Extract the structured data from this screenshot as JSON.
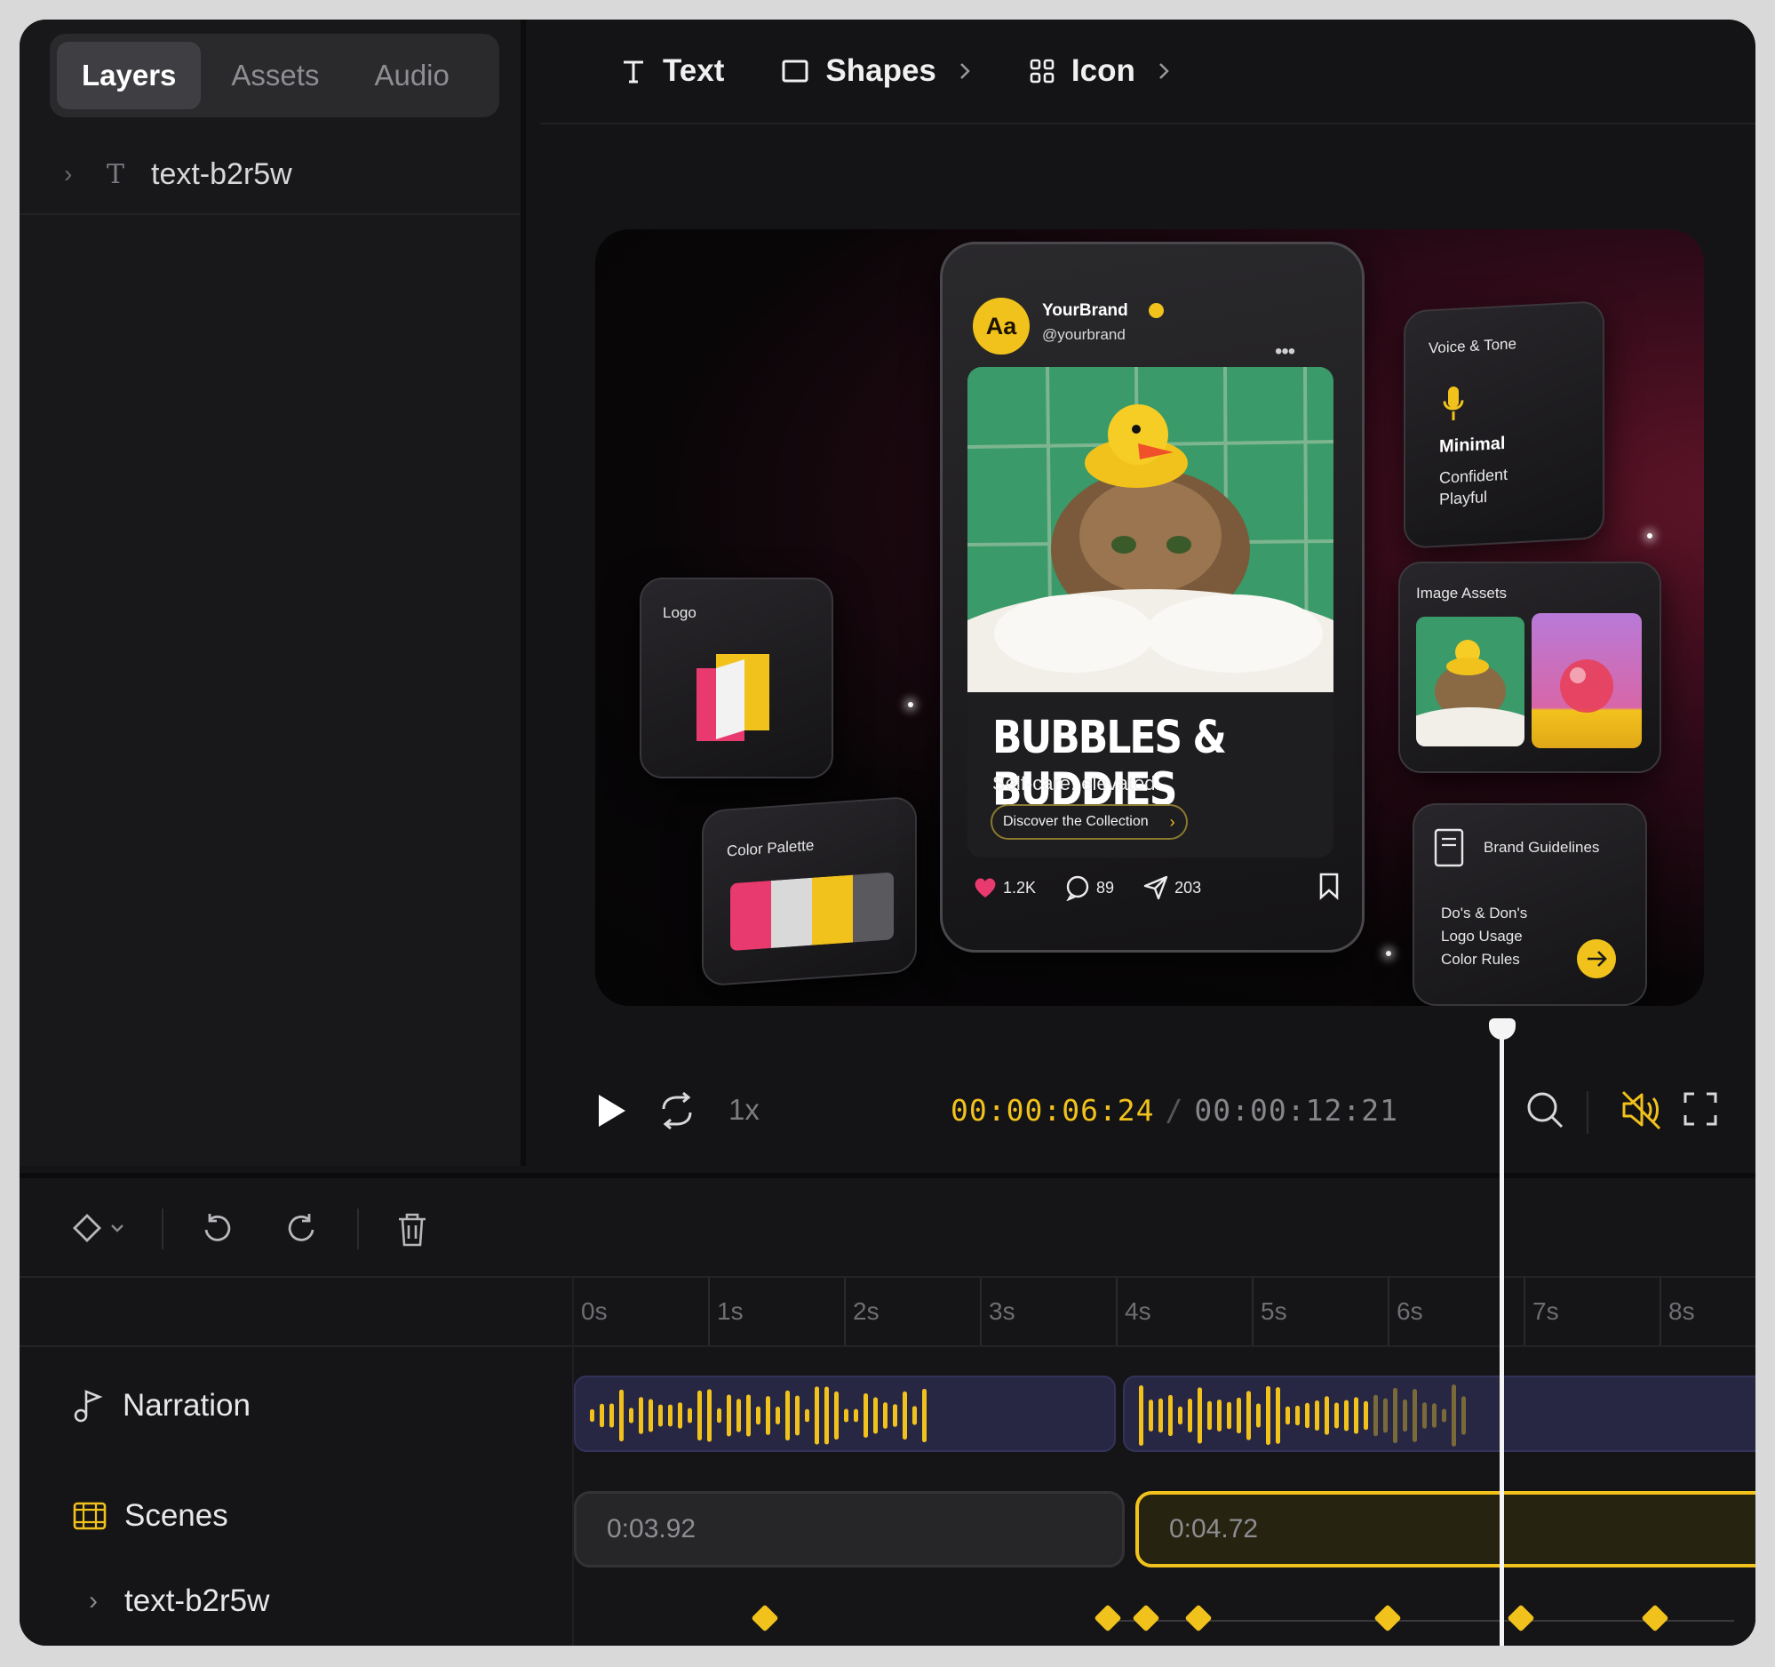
{
  "left_panel": {
    "tabs": [
      {
        "label": "Layers",
        "active": true
      },
      {
        "label": "Assets",
        "active": false
      },
      {
        "label": "Audio",
        "active": false
      }
    ],
    "layers": [
      {
        "name": "text-b2r5w",
        "type_icon": "T"
      }
    ]
  },
  "toolbar": {
    "text_label": "Text",
    "shapes_label": "Shapes",
    "icon_label": "Icon"
  },
  "preview": {
    "post": {
      "avatar_text": "Aa",
      "brand_name": "YourBrand",
      "handle": "@yourbrand",
      "title": "BUBBLES & BUDDIES",
      "subtitle": "Self-care, elevated.",
      "cta": "Discover the Collection",
      "likes": "1.2K",
      "comments": "89",
      "shares": "203"
    },
    "logo_card": {
      "label": "Logo"
    },
    "palette_card": {
      "label": "Color Palette",
      "colors": [
        "#e83a6e",
        "#d9d9d9",
        "#f2c21c",
        "#5a5a5e"
      ]
    },
    "voice_card": {
      "label": "Voice & Tone",
      "primary": "Minimal",
      "items": [
        "Confident",
        "Playful"
      ]
    },
    "images_card": {
      "label": "Image Assets"
    },
    "guidelines_card": {
      "label": "Brand Guidelines",
      "items": [
        "Do's & Don's",
        "Logo Usage",
        "Color Rules"
      ]
    }
  },
  "playback": {
    "speed": "1x",
    "current_time": "00:00:06:24",
    "separator": "/",
    "total_time": "00:00:12:21",
    "muted": true
  },
  "timeline": {
    "ticks": [
      "0s",
      "1s",
      "2s",
      "3s",
      "4s",
      "5s",
      "6s",
      "7s",
      "8s"
    ],
    "tracks": {
      "narration": "Narration",
      "scenes": "Scenes",
      "layer": "text-b2r5w"
    },
    "scenes": [
      {
        "duration": "0:03.92",
        "selected": false
      },
      {
        "duration": "0:04.72",
        "selected": true
      }
    ],
    "playhead_seconds": 6.8,
    "keyframe_seconds": [
      1.42,
      3.94,
      4.22,
      4.61,
      6.0,
      6.98,
      7.97
    ]
  },
  "colors": {
    "accent": "#f2c21c",
    "clip_bg": "#272744",
    "app_bg": "#141416"
  }
}
